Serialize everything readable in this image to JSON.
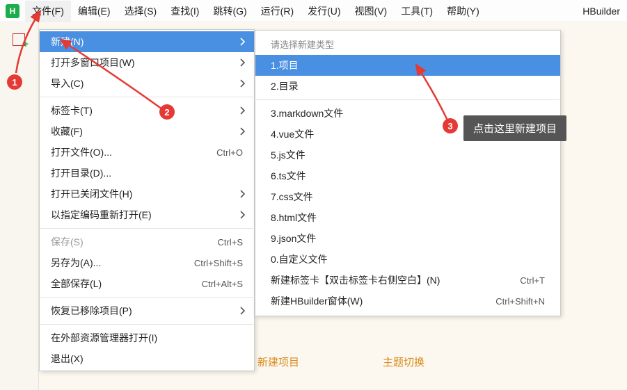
{
  "brand": "HBuilder",
  "menubar": {
    "items": [
      "文件(F)",
      "编辑(E)",
      "选择(S)",
      "查找(I)",
      "跳转(G)",
      "运行(R)",
      "发行(U)",
      "视图(V)",
      "工具(T)",
      "帮助(Y)"
    ],
    "activeIndex": 0
  },
  "fileMenu": {
    "groups": [
      [
        {
          "label": "新建(N)",
          "submenu": true,
          "highlight": true
        },
        {
          "label": "打开多窗口项目(W)",
          "submenu": true
        },
        {
          "label": "导入(C)",
          "submenu": true
        }
      ],
      [
        {
          "label": "标签卡(T)",
          "submenu": true
        },
        {
          "label": "收藏(F)",
          "submenu": true
        },
        {
          "label": "打开文件(O)...",
          "shortcut": "Ctrl+O"
        },
        {
          "label": "打开目录(D)..."
        },
        {
          "label": "打开已关闭文件(H)",
          "submenu": true
        },
        {
          "label": "以指定编码重新打开(E)",
          "submenu": true
        }
      ],
      [
        {
          "label": "保存(S)",
          "shortcut": "Ctrl+S",
          "disabled": true
        },
        {
          "label": "另存为(A)...",
          "shortcut": "Ctrl+Shift+S"
        },
        {
          "label": "全部保存(L)",
          "shortcut": "Ctrl+Alt+S"
        }
      ],
      [
        {
          "label": "恢复已移除项目(P)",
          "submenu": true
        }
      ],
      [
        {
          "label": "在外部资源管理器打开(I)"
        },
        {
          "label": "退出(X)"
        }
      ]
    ]
  },
  "newSubmenu": {
    "header": "请选择新建类型",
    "groups": [
      [
        {
          "label": "1.项目",
          "highlight": true
        },
        {
          "label": "2.目录"
        }
      ],
      [
        {
          "label": "3.markdown文件"
        },
        {
          "label": "4.vue文件"
        },
        {
          "label": "5.js文件"
        },
        {
          "label": "6.ts文件"
        },
        {
          "label": "7.css文件"
        },
        {
          "label": "8.html文件"
        },
        {
          "label": "9.json文件"
        },
        {
          "label": "0.自定义文件"
        },
        {
          "label": "新建标签卡【双击标签卡右侧空白】(N)",
          "shortcut": "Ctrl+T"
        },
        {
          "label": "新建HBuilder窗体(W)",
          "shortcut": "Ctrl+Shift+N"
        }
      ]
    ]
  },
  "annotations": {
    "step1": "1",
    "step2": "2",
    "step3": "3",
    "tooltip": "点击这里新建项目"
  },
  "bottom": {
    "link1": "新建项目",
    "link2": "主题切换"
  },
  "colors": {
    "highlight": "#4a90e2",
    "badge": "#e53935",
    "brandGreen": "#1aad49",
    "linkOrange": "#d88b1e"
  }
}
